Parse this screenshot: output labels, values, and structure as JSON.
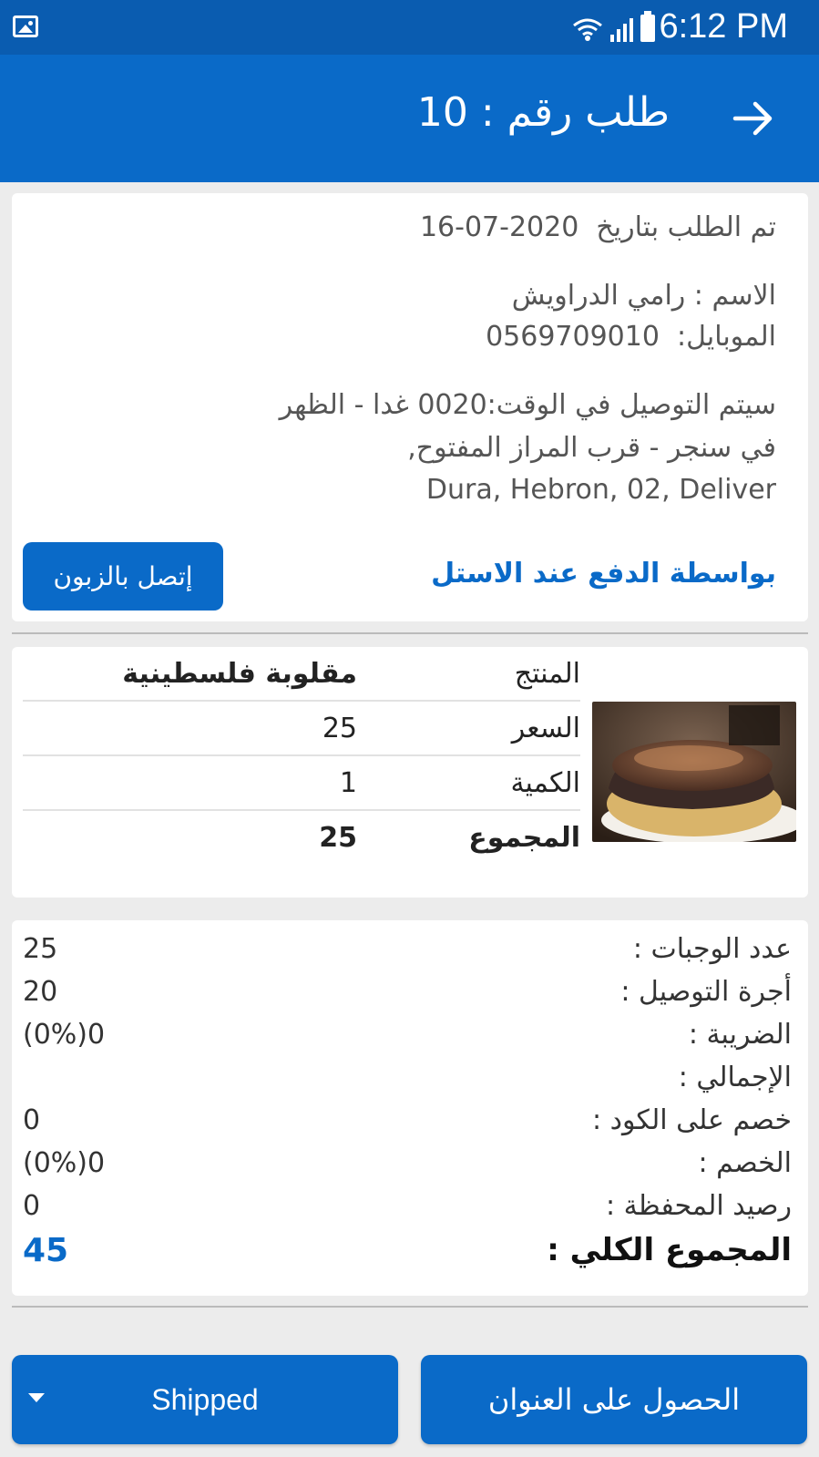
{
  "status_bar": {
    "time": "6:12 PM",
    "icons": [
      "image-notification-icon",
      "wifi-icon",
      "signal-icon",
      "battery-icon"
    ]
  },
  "app_bar": {
    "title": "طلب رقم : 10",
    "back_icon": "arrow-right-icon"
  },
  "order_info": {
    "date_label": "تم الطلب بتاريخ",
    "date_value": "16-07-2020",
    "name_line": "الاسم : رامي الدراويش",
    "mobile_label": "الموبايل:",
    "mobile_value": "0569709010",
    "delivery_line1": "سيتم التوصيل في الوقت:0020 غدا - الظهر",
    "delivery_line2": "في سنجر - قرب المراز المفتوح,",
    "delivery_line3": "Dura, Hebron, 02, Deliver",
    "payment_method": "بواسطة الدفع عند الاستل",
    "call_button": "إتصل بالزبون"
  },
  "product": {
    "rows": [
      {
        "label": "المنتج",
        "value": "مقلوبة فلسطينية"
      },
      {
        "label": "السعر",
        "value": "25"
      },
      {
        "label": "الكمية",
        "value": "1"
      },
      {
        "label": "المجموع",
        "value": "25"
      }
    ],
    "image": "maqluba-dish-photo"
  },
  "summary": {
    "rows": [
      {
        "label": "عدد الوجبات :",
        "value": "25"
      },
      {
        "label": "أجرة التوصيل :",
        "value": "20"
      },
      {
        "label": "الضريبة :",
        "value": "(0%)0"
      },
      {
        "label": "الإجمالي :",
        "value": ""
      },
      {
        "label": "خصم على الكود :",
        "value": "0"
      },
      {
        "label": "الخصم :",
        "value": "(0%)0"
      },
      {
        "label": "رصيد المحفظة :",
        "value": "0"
      }
    ],
    "total_label": "المجموع الكلي :",
    "total_value": "45"
  },
  "actions": {
    "address_button": "الحصول على العنوان",
    "status_value": "Shipped"
  },
  "colors": {
    "primary": "#0a6ac8",
    "status_bar": "#0a5cb0",
    "background": "#ececec"
  }
}
